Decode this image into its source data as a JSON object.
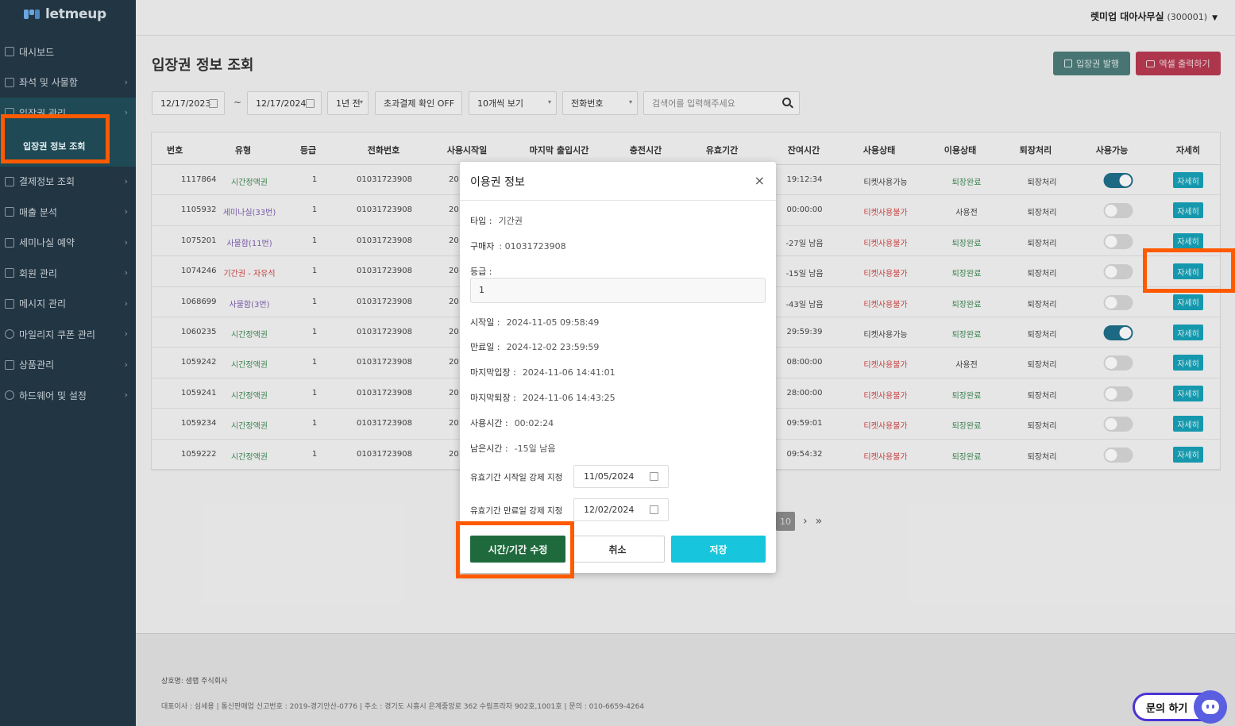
{
  "app": {
    "logo_text": "letmeup"
  },
  "sidebar": {
    "items": [
      {
        "label": "대시보드",
        "chevron": false
      },
      {
        "label": "좌석 및 사물함",
        "chevron": true
      },
      {
        "label": "입장권 관리",
        "chevron": true
      },
      {
        "label": "결제정보 조회",
        "chevron": true
      },
      {
        "label": "매출 분석",
        "chevron": true
      },
      {
        "label": "세미나실 예약",
        "chevron": true
      },
      {
        "label": "회원 관리",
        "chevron": true
      },
      {
        "label": "메시지 관리",
        "chevron": true
      },
      {
        "label": "마일리지 쿠폰 관리",
        "chevron": true
      },
      {
        "label": "상품관리",
        "chevron": true
      },
      {
        "label": "하드웨어 및 설정",
        "chevron": true
      }
    ],
    "submenu_active": "입장권 정보 조회"
  },
  "header": {
    "account_name": "렛미업 대아사무실",
    "account_code": "(300001)",
    "caret": "▼"
  },
  "page": {
    "title": "입장권 정보 조회",
    "issue_button": "입장권 발행",
    "excel_button": "엑셀 출력하기"
  },
  "filters": {
    "date_from": "12/17/2023",
    "tilde": "~",
    "date_to": "12/17/2024",
    "period": "1년 전",
    "overpay": "초과결제 확인 OFF",
    "page_size": "10개씩 보기",
    "search_type": "전화번호",
    "search_placeholder": "검색어를 입력해주세요"
  },
  "table": {
    "headers": [
      "번호",
      "유형",
      "등급",
      "전화번호",
      "사용시작일",
      "마지막 출입시간",
      "충전시간",
      "유효기간",
      "잔여시간",
      "사용상태",
      "이용상태",
      "퇴장처리",
      "사용가능",
      "자세히"
    ],
    "rows": [
      {
        "no": "1117864",
        "type": "시간정액권",
        "type_color": "green",
        "grade": "1",
        "phone": "01031723908",
        "start": "20",
        "remain": "19:12:34",
        "use_state": "티켓사용가능",
        "use_red": false,
        "status": "퇴장완료",
        "status_green": true,
        "exit": "퇴장처리",
        "enabled": true,
        "detail": "자세히"
      },
      {
        "no": "1105932",
        "type": "세미나실(33번)",
        "type_color": "purple",
        "grade": "1",
        "phone": "01031723908",
        "start": "20",
        "remain": "00:00:00",
        "use_state": "티켓사용불가",
        "use_red": true,
        "status": "사용전",
        "status_green": false,
        "exit": "퇴장처리",
        "enabled": false,
        "detail": "자세히"
      },
      {
        "no": "1075201",
        "type": "사물함(11번)",
        "type_color": "purple",
        "grade": "1",
        "phone": "01031723908",
        "start": "20",
        "remain": "-27일 남음",
        "use_state": "티켓사용불가",
        "use_red": true,
        "status": "퇴장완료",
        "status_green": true,
        "exit": "퇴장처리",
        "enabled": false,
        "detail": "자세히"
      },
      {
        "no": "1074246",
        "type": "기간권 - 자유석",
        "type_color": "red",
        "grade": "1",
        "phone": "01031723908",
        "start": "20",
        "remain": "-15일 남음",
        "use_state": "티켓사용불가",
        "use_red": true,
        "status": "퇴장완료",
        "status_green": true,
        "exit": "퇴장처리",
        "enabled": false,
        "detail": "자세히"
      },
      {
        "no": "1068699",
        "type": "사물함(3번)",
        "type_color": "purple",
        "grade": "1",
        "phone": "01031723908",
        "start": "20",
        "remain": "-43일 남음",
        "use_state": "티켓사용불가",
        "use_red": true,
        "status": "퇴장완료",
        "status_green": true,
        "exit": "퇴장처리",
        "enabled": false,
        "detail": "자세히"
      },
      {
        "no": "1060235",
        "type": "시간정액권",
        "type_color": "green",
        "grade": "1",
        "phone": "01031723908",
        "start": "20",
        "remain": "29:59:39",
        "use_state": "티켓사용가능",
        "use_red": false,
        "status": "퇴장완료",
        "status_green": true,
        "exit": "퇴장처리",
        "enabled": true,
        "detail": "자세히"
      },
      {
        "no": "1059242",
        "type": "시간정액권",
        "type_color": "green",
        "grade": "1",
        "phone": "01031723908",
        "start": "20",
        "remain": "08:00:00",
        "use_state": "티켓사용불가",
        "use_red": true,
        "status": "사용전",
        "status_green": false,
        "exit": "퇴장처리",
        "enabled": false,
        "detail": "자세히"
      },
      {
        "no": "1059241",
        "type": "시간정액권",
        "type_color": "green",
        "grade": "1",
        "phone": "01031723908",
        "start": "20",
        "remain": "28:00:00",
        "use_state": "티켓사용불가",
        "use_red": true,
        "status": "퇴장완료",
        "status_green": true,
        "exit": "퇴장처리",
        "enabled": false,
        "detail": "자세히"
      },
      {
        "no": "1059234",
        "type": "시간정액권",
        "type_color": "green",
        "grade": "1",
        "phone": "01031723908",
        "start": "20",
        "remain": "09:59:01",
        "use_state": "티켓사용불가",
        "use_red": true,
        "status": "퇴장완료",
        "status_green": true,
        "exit": "퇴장처리",
        "enabled": false,
        "detail": "자세히"
      },
      {
        "no": "1059222",
        "type": "시간정액권",
        "type_color": "green",
        "grade": "1",
        "phone": "01031723908",
        "start": "20",
        "remain": "09:54:32",
        "use_state": "티켓사용불가",
        "use_red": true,
        "status": "퇴장완료",
        "status_green": true,
        "exit": "퇴장처리",
        "enabled": false,
        "detail": "자세히"
      }
    ]
  },
  "pagination": {
    "current": "10",
    "next": "›",
    "last": "»"
  },
  "footer": {
    "company": "상호명: 샘랩 주식회사",
    "info": "대표이사 : 심세용  |  통신판매업 신고번호 : 2019-경기안산-0776  |  주소 : 경기도 시흥시 은계중앙로 362 수림프라자 902호,1001호  |  문의 : 010-6659-4264"
  },
  "chat": {
    "label": "문의 하기"
  },
  "modal": {
    "title": "이용권 정보",
    "close": "×",
    "type_label": "타입 :",
    "type_value": "기간권",
    "buyer_label": "구매자",
    "buyer_value": ": 01031723908",
    "grade_label": "등급    :",
    "grade_value": "1",
    "start_label": "시작일 :",
    "start_value": "2024-11-05 09:58:49",
    "end_label": "만료일 :",
    "end_value": "2024-12-02 23:59:59",
    "last_in_label": "마지막입장 :",
    "last_in_value": "2024-11-06 14:41:01",
    "last_out_label": "마지막퇴장 :",
    "last_out_value": "2024-11-06 14:43:25",
    "used_label": "사용시간 :",
    "used_value": "00:02:24",
    "remain_label": "남은시간 :",
    "remain_value": "-15일 남음",
    "force_start_label": "유효기간 시작일 강제 지정",
    "force_start_value": "11/05/2024",
    "force_end_label": "유효기간 만료일 강제 지정",
    "force_end_value": "12/02/2024",
    "edit_button": "시간/기간 수정",
    "cancel_button": "취소",
    "save_button": "저장"
  },
  "colors": {
    "sidebar_bg": "#223542",
    "accent_teal": "#17a2b8",
    "highlight": "#ff5a00",
    "edit_green": "#1f6a3d",
    "save_cyan": "#17c6dc"
  }
}
